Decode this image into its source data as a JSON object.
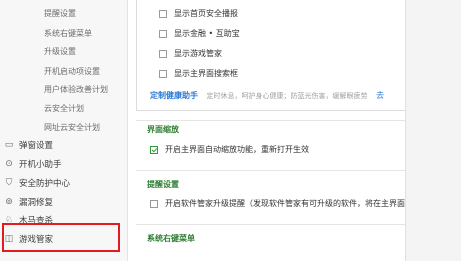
{
  "sidebar": {
    "sub_items": [
      "提醒设置",
      "系统右键菜单",
      "升级设置",
      "开机启动项设置",
      "用户体验改善计划",
      "云安全计划",
      "网址云安全计划"
    ],
    "main_items": [
      {
        "label": "弹窗设置",
        "icon": "popup-icon"
      },
      {
        "label": "开机小助手",
        "icon": "rocket-icon"
      },
      {
        "label": "安全防护中心",
        "icon": "shield-icon"
      },
      {
        "label": "漏洞修复",
        "icon": "patch-icon"
      },
      {
        "label": "木马查杀",
        "icon": "trojan-icon"
      },
      {
        "label": "游戏管家",
        "icon": "gamepad-icon"
      }
    ]
  },
  "content": {
    "checkboxes_top": [
      {
        "label": "显示首页安全播报",
        "checked": false
      },
      {
        "label": "显示金融 • 互助宝",
        "checked": false
      },
      {
        "label": "显示游戏管家",
        "checked": false
      },
      {
        "label": "显示主界面搜索框",
        "checked": false
      }
    ],
    "health": {
      "title": "定制健康助手",
      "desc": "定时休息，呵护身心健康；防蓝光伤害，缓解眼疲劳",
      "link": "去"
    },
    "section_zoom": {
      "title": "界面缩放",
      "option": {
        "label": "开启主界面自动缩放功能，重新打开生效",
        "checked": true
      }
    },
    "section_remind": {
      "title": "提醒设置",
      "option": {
        "label": "开启软件管家升级提醒（发现软件管家有可升级的软件，将在主界面",
        "checked": false
      }
    },
    "section_context": {
      "title": "系统右键菜单"
    }
  },
  "colors": {
    "accent_green": "#2e7d32",
    "highlight_red": "#e11b22",
    "link_blue": "#2d7ad6"
  }
}
